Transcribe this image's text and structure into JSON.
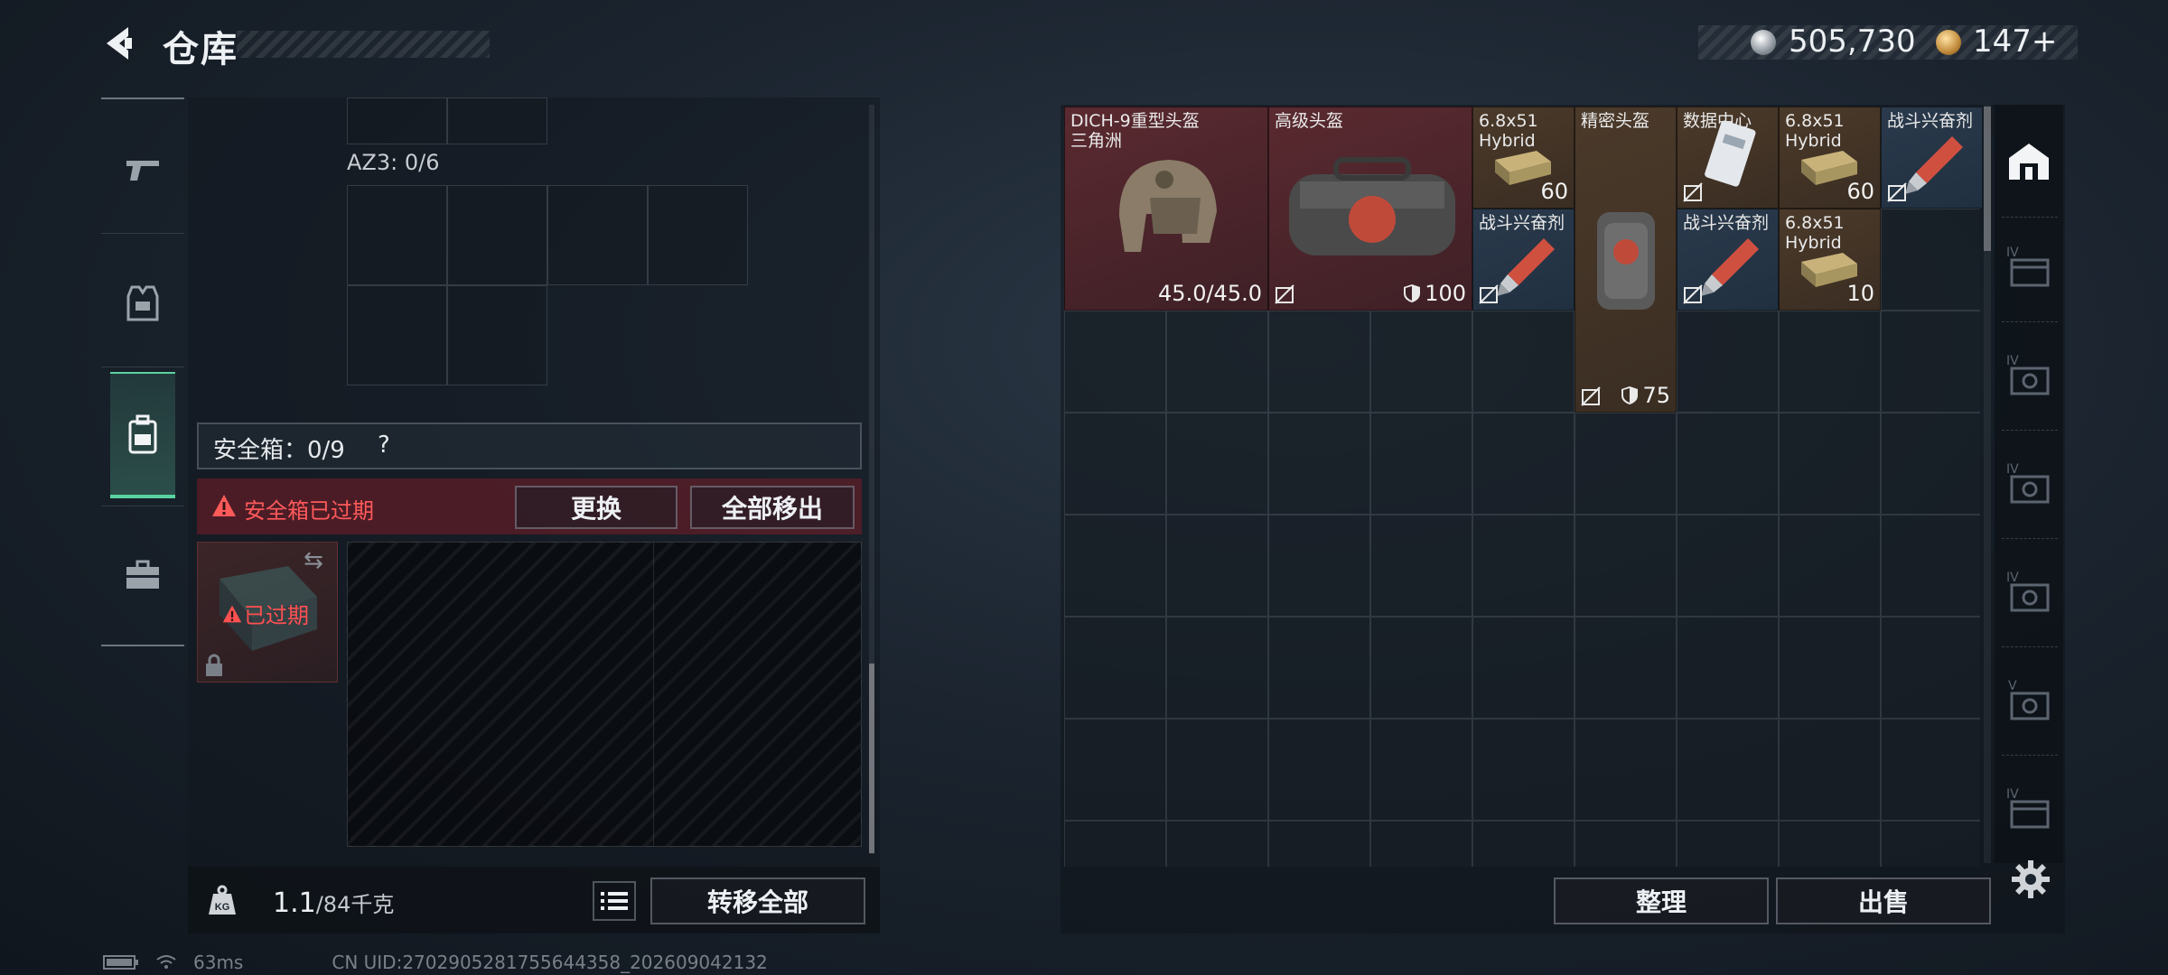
{
  "header": {
    "title": "仓库",
    "currency": {
      "silver_amount": "505,730",
      "gold_amount": "147+"
    }
  },
  "left_tabs": [
    {
      "name": "weapons",
      "icon": "pistol-icon"
    },
    {
      "name": "armor",
      "icon": "vest-icon"
    },
    {
      "name": "backpack",
      "icon": "backpack-icon",
      "active": true
    },
    {
      "name": "toolbox",
      "icon": "toolbox-icon"
    }
  ],
  "loadout": {
    "az3_label": "AZ3: 0/6"
  },
  "safebox": {
    "label": "安全箱：0/9",
    "help": "?",
    "expired_notice": "安全箱已过期",
    "replace_label": "更换",
    "move_all_label": "全部移出",
    "item_expired_label": "已过期"
  },
  "weight": {
    "current": "1.1",
    "max": "/84千克"
  },
  "transfer_all_label": "转移全部",
  "stash": {
    "items": [
      {
        "name_line1": "DICH-9重型头盔",
        "name_line2": "三角洲",
        "value": "45.0/45.0",
        "rarity": "red"
      },
      {
        "name_line1": "高级头盔",
        "durability": "100",
        "rarity": "red"
      },
      {
        "name_line1": "6.8x51",
        "name_line2": "Hybrid",
        "value": "60",
        "rarity": "gold"
      },
      {
        "name_line1": "精密头盔",
        "durability": "75",
        "rarity": "gold"
      },
      {
        "name_line1": "数据中心",
        "rarity": "gold"
      },
      {
        "name_line1": "6.8x51",
        "name_line2": "Hybrid",
        "value": "60",
        "rarity": "gold"
      },
      {
        "name_line1": "战斗兴奋剂",
        "rarity": "blue"
      },
      {
        "name_line1": "战斗兴奋剂",
        "rarity": "blue"
      },
      {
        "name_line1": "战斗兴奋剂",
        "rarity": "blue"
      },
      {
        "name_line1": "6.8x51",
        "name_line2": "Hybrid",
        "value": "10",
        "rarity": "gold"
      }
    ]
  },
  "actions": {
    "sort_label": "整理",
    "sell_label": "出售"
  },
  "status_bar": {
    "ping": "63ms",
    "uid": "CN UID:2702905281755644358_202609042132"
  },
  "colors": {
    "accent_green": "#5ad3a1",
    "expired_red": "#ff5a5a",
    "rarity_red": "#5a2a30",
    "rarity_gold": "#4b3a2a",
    "rarity_blue": "#2a3a4c"
  }
}
